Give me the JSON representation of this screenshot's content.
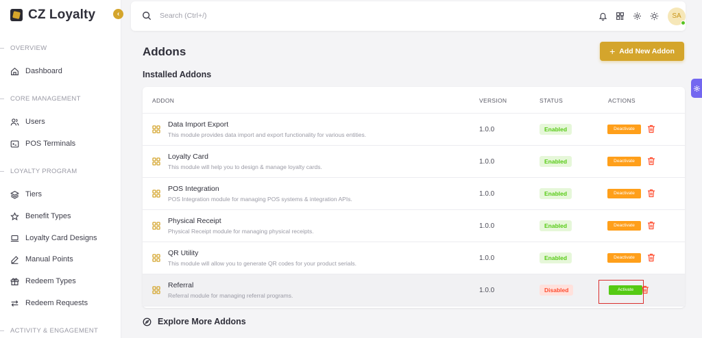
{
  "brand": {
    "name": "CZ Loyalty"
  },
  "sidebar": {
    "collapse_glyph": "‹",
    "sections": [
      {
        "label": "OVERVIEW"
      },
      {
        "label": "CORE MANAGEMENT"
      },
      {
        "label": "LOYALTY PROGRAM"
      },
      {
        "label": "ACTIVITY & ENGAGEMENT"
      }
    ],
    "items": [
      {
        "label": "Dashboard",
        "icon": "home-icon"
      },
      {
        "label": "Users",
        "icon": "users-icon"
      },
      {
        "label": "POS Terminals",
        "icon": "terminal-icon"
      },
      {
        "label": "Tiers",
        "icon": "layers-icon"
      },
      {
        "label": "Benefit Types",
        "icon": "star-icon"
      },
      {
        "label": "Loyalty Card Designs",
        "icon": "laptop-icon"
      },
      {
        "label": "Manual Points",
        "icon": "pen-icon"
      },
      {
        "label": "Redeem Types",
        "icon": "gift-icon"
      },
      {
        "label": "Redeem Requests",
        "icon": "transfer-icon"
      }
    ]
  },
  "topbar": {
    "search_placeholder": "Search (Ctrl+/)",
    "avatar_initials": "SA"
  },
  "page": {
    "title": "Addons",
    "add_button_label": "Add New Addon",
    "add_button_glyph": "+",
    "installed_title": "Installed Addons",
    "explore_title": "Explore More Addons"
  },
  "table": {
    "columns": [
      "ADDON",
      "VERSION",
      "STATUS",
      "ACTIONS"
    ],
    "rows": [
      {
        "name": "Data Import Export",
        "description": "This module provides data import and export functionality for various entities.",
        "version": "1.0.0",
        "status": "Enabled",
        "action": "Deactivate"
      },
      {
        "name": "Loyalty Card",
        "description": "This module will help you to design & manage loyalty cards.",
        "version": "1.0.0",
        "status": "Enabled",
        "action": "Deactivate"
      },
      {
        "name": "POS Integration",
        "description": "POS Integration module for managing POS systems & integration APIs.",
        "version": "1.0.0",
        "status": "Enabled",
        "action": "Deactivate"
      },
      {
        "name": "Physical Receipt",
        "description": "Physical Receipt module for managing physical receipts.",
        "version": "1.0.0",
        "status": "Enabled",
        "action": "Deactivate"
      },
      {
        "name": "QR Utility",
        "description": "This module will allow you to generate QR codes for your product serials.",
        "version": "1.0.0",
        "status": "Enabled",
        "action": "Deactivate"
      },
      {
        "name": "Referral",
        "description": "Referral module for managing referral programs.",
        "version": "1.0.0",
        "status": "Disabled",
        "action": "Activate"
      }
    ]
  },
  "colors": {
    "accent": "#d4a52c",
    "enabled": "#56ca14",
    "disabled": "#ff4c2f",
    "deactivate": "#ff9f1a",
    "highlight": "#d92d2d",
    "settings_tab": "#7367f0"
  }
}
